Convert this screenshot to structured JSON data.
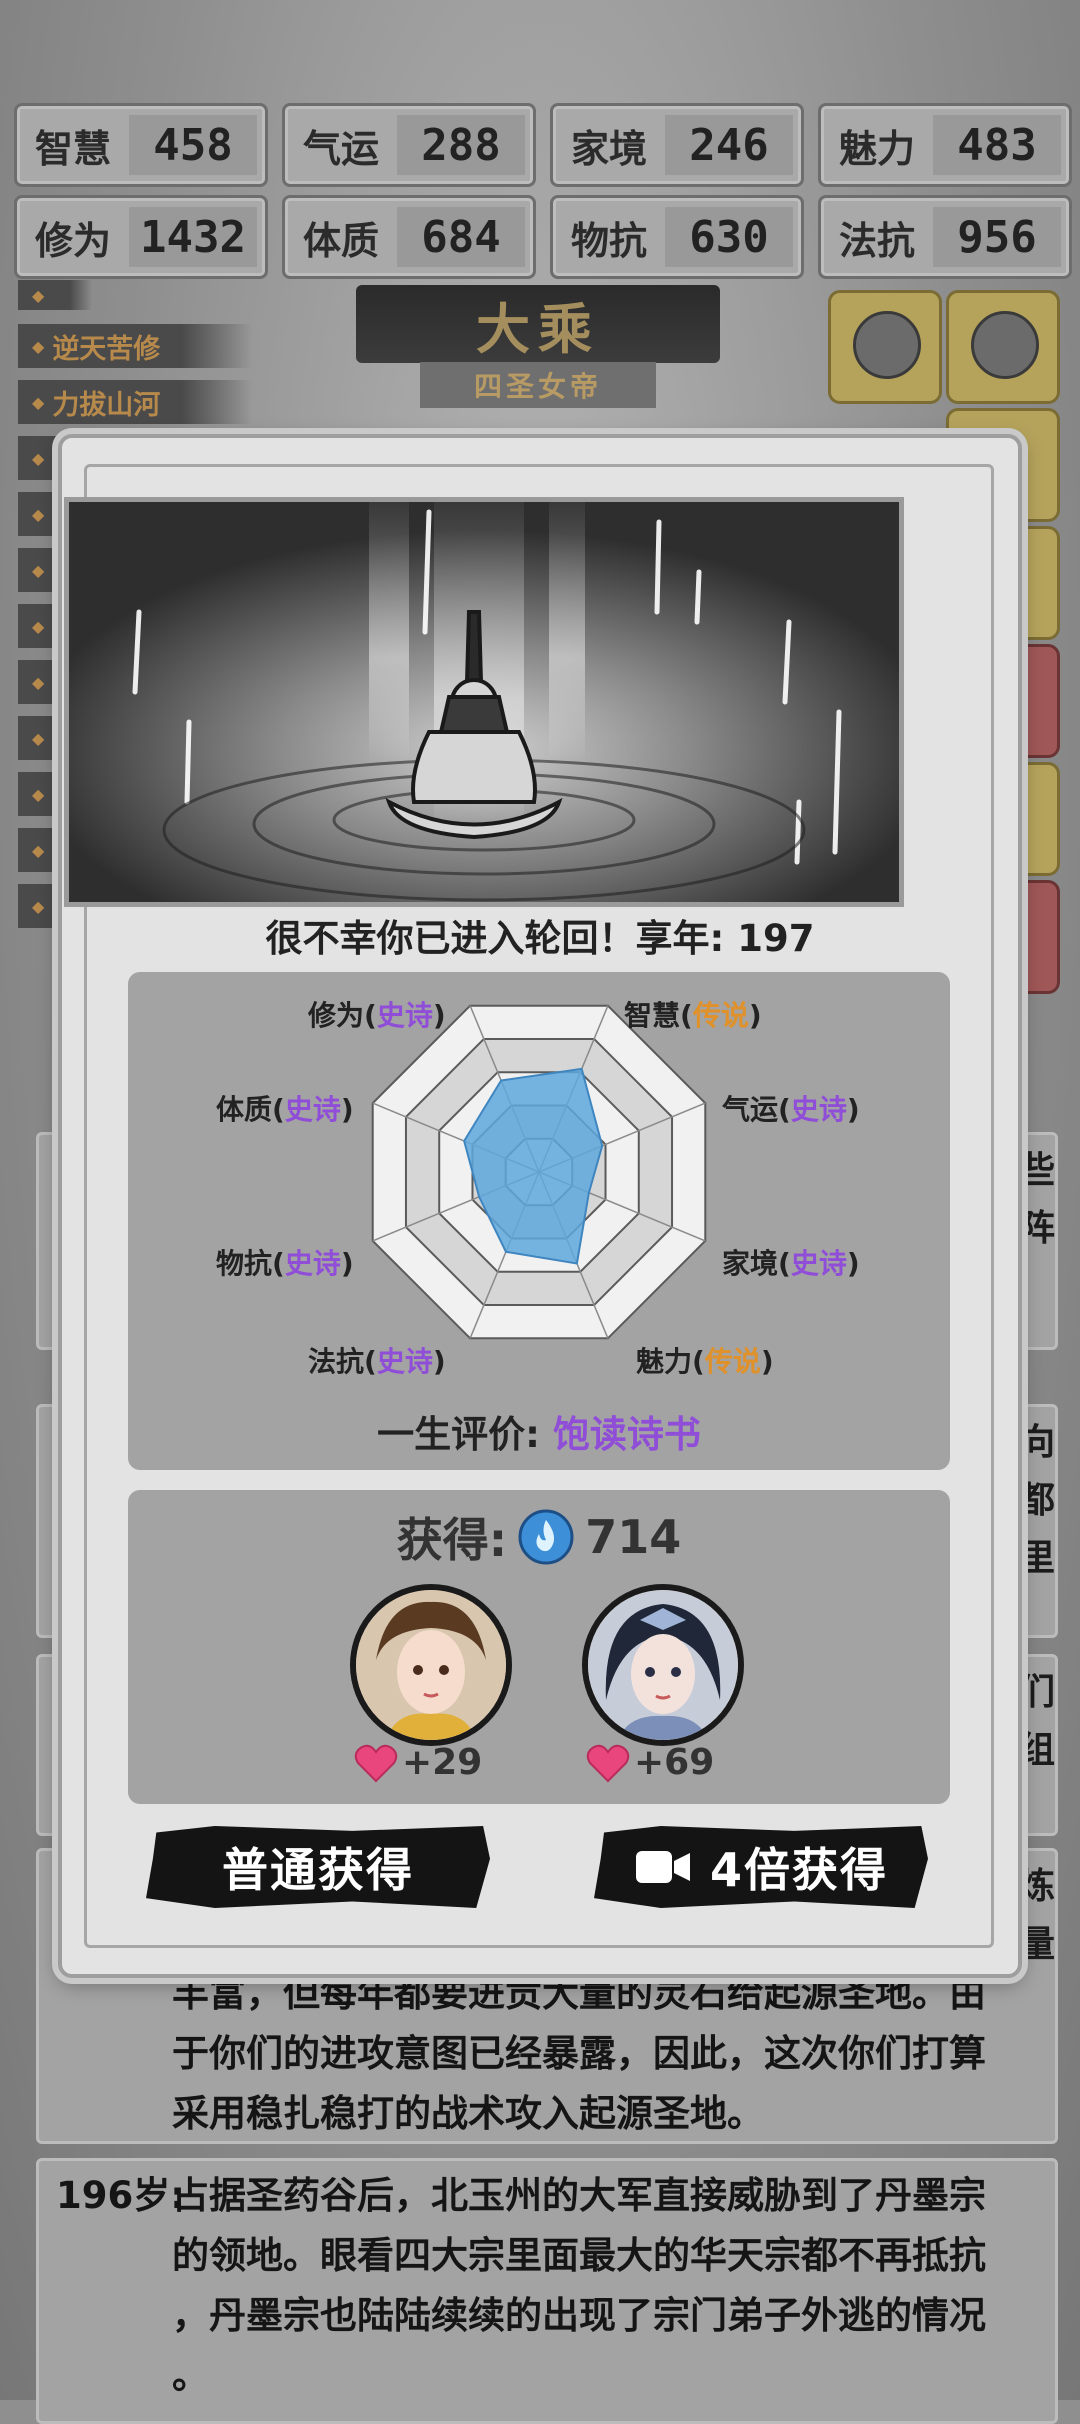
{
  "stats": [
    {
      "name": "智慧",
      "value": "458"
    },
    {
      "name": "气运",
      "value": "288"
    },
    {
      "name": "家境",
      "value": "246"
    },
    {
      "name": "魅力",
      "value": "483"
    },
    {
      "name": "修为",
      "value": "1432"
    },
    {
      "name": "体质",
      "value": "684"
    },
    {
      "name": "物抗",
      "value": "630"
    },
    {
      "name": "法抗",
      "value": "956"
    }
  ],
  "realm": {
    "title": "大乘",
    "subtitle": "四圣女帝"
  },
  "traits": [
    "逆天苦修",
    "力拔山河"
  ],
  "log": {
    "right_chars_1": "些\n阵",
    "right_chars_2": "向\n都\n里",
    "right_chars_3": "们\n组",
    "right_chars_4": "炼\n量",
    "entry_195": [
      "丰富，但每年都要进贡大量的灵石给起源圣地。由",
      "于你们的进攻意图已经暴露，因此，这次你们打算",
      "采用稳扎稳打的战术攻入起源圣地。"
    ],
    "entry_196_age": "196岁:",
    "entry_196": [
      "占据圣药谷后，北玉州的大军直接威胁到了丹墨宗",
      "的领地。眼看四大宗里面最大的华天宗都不再抵抗",
      "，丹墨宗也陆陆续续的出现了宗门弟子外逃的情况",
      "。"
    ]
  },
  "modal": {
    "death_message": "很不幸你已进入轮回！享年: 197",
    "radar_labels": [
      {
        "attr": "修为",
        "rank": "史诗",
        "tier": "epic"
      },
      {
        "attr": "智慧",
        "rank": "传说",
        "tier": "legend"
      },
      {
        "attr": "体质",
        "rank": "史诗",
        "tier": "epic"
      },
      {
        "attr": "气运",
        "rank": "史诗",
        "tier": "epic"
      },
      {
        "attr": "物抗",
        "rank": "史诗",
        "tier": "epic"
      },
      {
        "attr": "家境",
        "rank": "史诗",
        "tier": "epic"
      },
      {
        "attr": "法抗",
        "rank": "史诗",
        "tier": "epic"
      },
      {
        "attr": "魅力",
        "rank": "传说",
        "tier": "legend"
      }
    ],
    "radar_levels": {
      "修为": 0.55,
      "智慧": 0.62,
      "气运": 0.38,
      "家境": 0.3,
      "魅力": 0.55,
      "法抗": 0.48,
      "物抗": 0.36,
      "体质": 0.45
    },
    "evaluation_label": "一生评价:",
    "evaluation_value": "饱读诗书",
    "gain_label": "获得:",
    "gain_value": "714",
    "companions": [
      {
        "affinity": "+29"
      },
      {
        "affinity": "+69"
      }
    ],
    "btn_normal": "普通获得",
    "btn_video": "4倍获得"
  },
  "colors": {
    "epic": "#8f4dd8",
    "legend": "#e0912a",
    "radar_fill": "#5ea8dd"
  },
  "icons": [
    "spirit-flame-icon",
    "heart-icon",
    "video-camera-icon"
  ]
}
